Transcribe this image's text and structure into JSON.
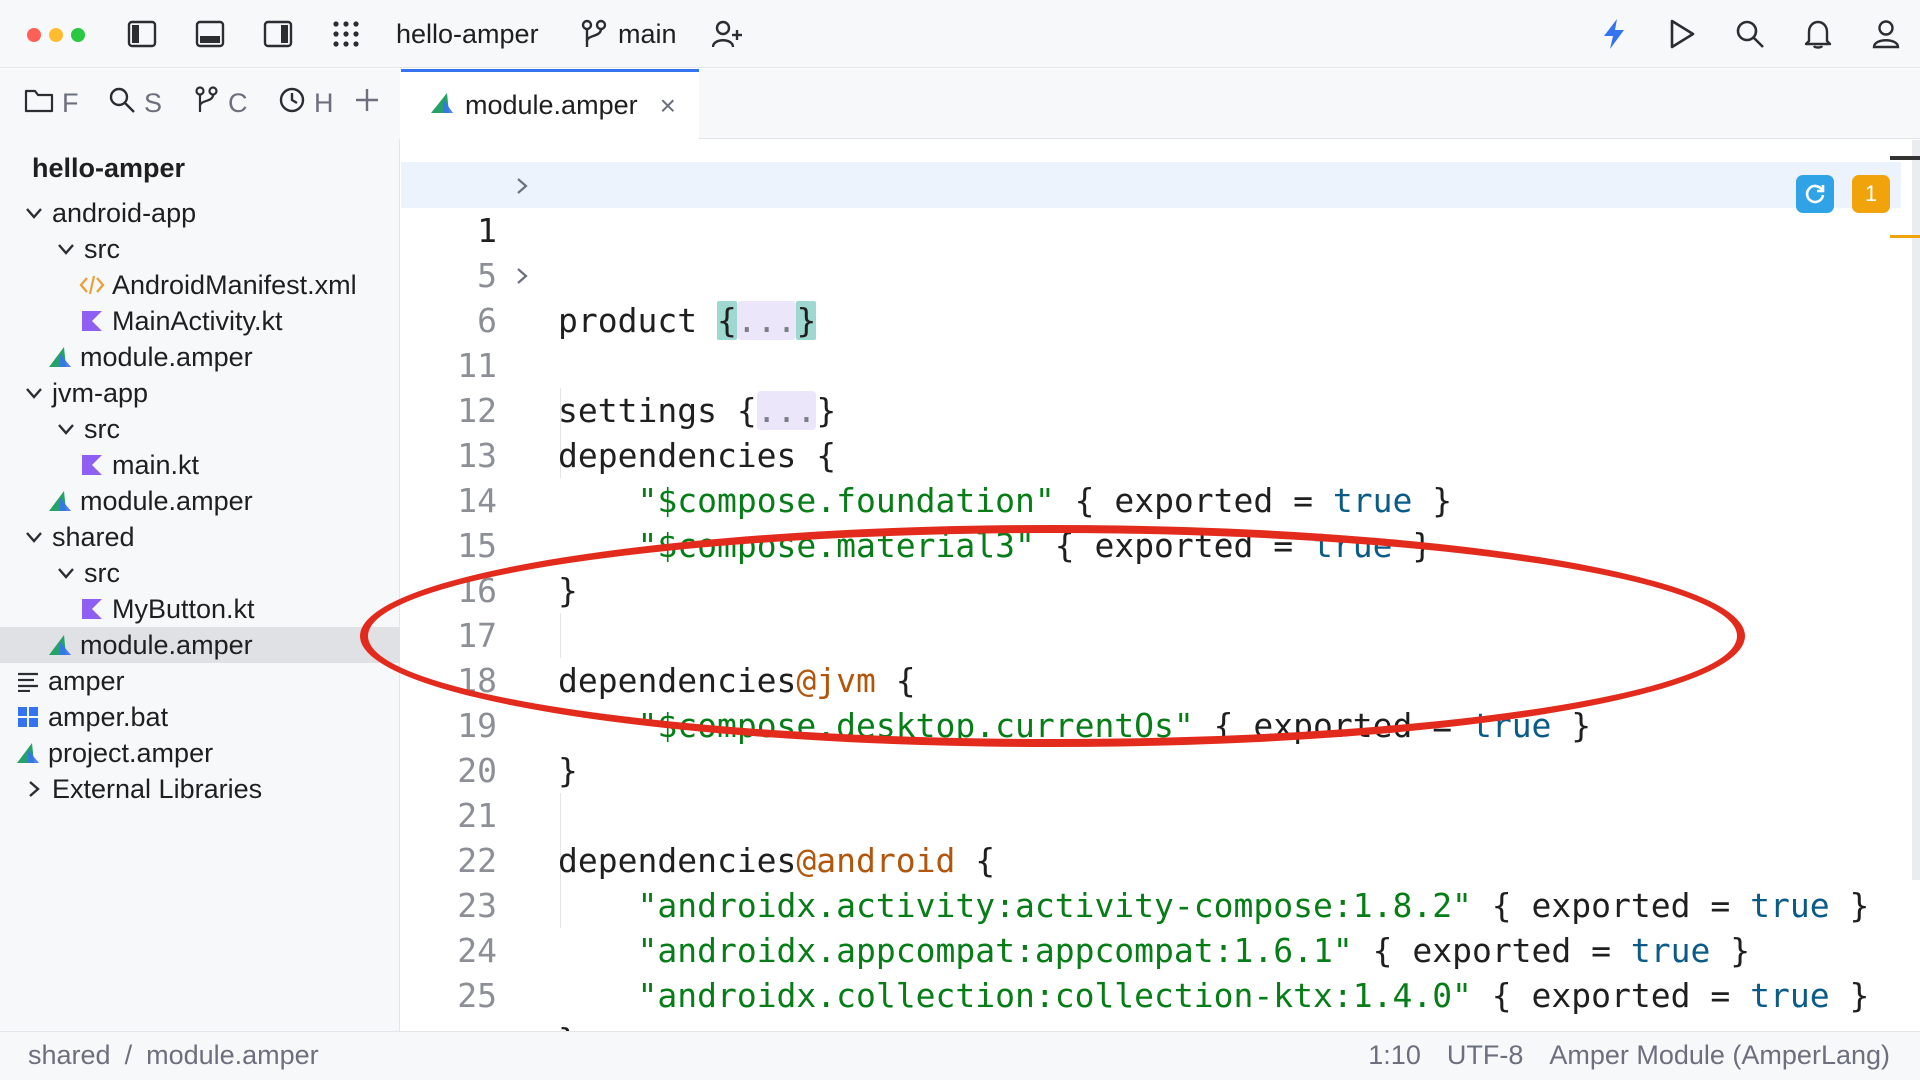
{
  "titlebar": {
    "project_name": "hello-amper",
    "branch": "main"
  },
  "left_tools": {
    "project_label": "F",
    "search_label": "S",
    "vcs_label": "C",
    "history_label": "H"
  },
  "project_tree": {
    "root": "hello-amper",
    "items": [
      {
        "label": "android-app",
        "type": "module-folder"
      },
      {
        "label": "src",
        "type": "folder"
      },
      {
        "label": "AndroidManifest.xml",
        "type": "xml-file"
      },
      {
        "label": "MainActivity.kt",
        "type": "kotlin-file"
      },
      {
        "label": "module.amper",
        "type": "amper-file"
      },
      {
        "label": "jvm-app",
        "type": "module-folder"
      },
      {
        "label": "src",
        "type": "folder"
      },
      {
        "label": "main.kt",
        "type": "kotlin-file"
      },
      {
        "label": "module.amper",
        "type": "amper-file"
      },
      {
        "label": "shared",
        "type": "module-folder"
      },
      {
        "label": "src",
        "type": "folder"
      },
      {
        "label": "MyButton.kt",
        "type": "kotlin-file"
      },
      {
        "label": "module.amper",
        "type": "amper-file",
        "selected": true
      },
      {
        "label": "amper",
        "type": "text-file"
      },
      {
        "label": "amper.bat",
        "type": "windows-file"
      },
      {
        "label": "project.amper",
        "type": "amper-file"
      },
      {
        "label": "External Libraries",
        "type": "libraries"
      }
    ]
  },
  "editor_tab": {
    "label": "module.amper",
    "close_glyph": "×"
  },
  "editor": {
    "line_numbers": [
      "1",
      "5",
      "6",
      "11",
      "12",
      "13",
      "14",
      "15",
      "16",
      "17",
      "18",
      "19",
      "20",
      "21",
      "22",
      "23",
      "24",
      "25"
    ],
    "warning_count": "1",
    "folded_placeholder": "...",
    "tokens": {
      "product": "product",
      "settings": "settings",
      "dependencies": "dependencies",
      "exported": "exported",
      "true": "true",
      "qualifier_jvm": "@jvm",
      "qualifier_android": "@android",
      "dep_foundation": "\"$compose.foundation\"",
      "dep_material3": "\"$compose.material3\"",
      "dep_desktop": "\"$compose.desktop.currentOs\"",
      "dep_activity": "\"androidx.activity:activity-compose:1.8.2\"",
      "dep_appcompat": "\"androidx.appcompat:appcompat:1.6.1\"",
      "dep_collection": "\"androidx.collection:collection-ktx:1.4.0\""
    }
  },
  "statusbar": {
    "breadcrumb_module": "shared",
    "breadcrumb_sep": "/",
    "breadcrumb_file": "module.amper",
    "caret_position": "1:10",
    "encoding": "UTF-8",
    "file_type": "Amper Module (AmperLang)"
  },
  "colors": {
    "accent": "#3574f0",
    "string": "#067d17",
    "keyword": "#0b5b89",
    "qualifier": "#b2560c",
    "annotation_oval": "#e32b1d"
  }
}
